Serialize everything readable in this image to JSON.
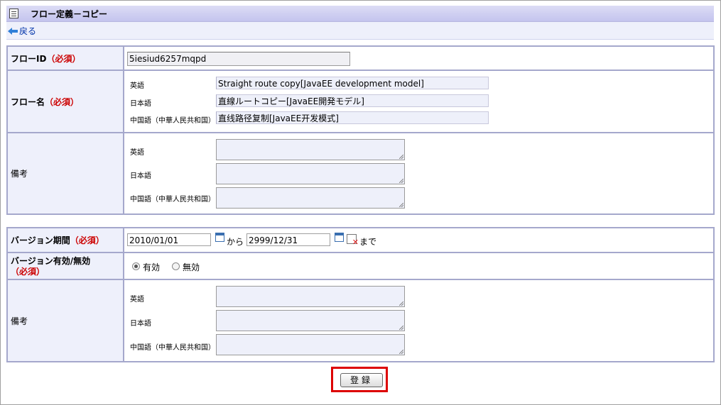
{
  "header": {
    "title": "フロー定義－コピー",
    "back_label": "戻る"
  },
  "flow": {
    "id_label": "フローID",
    "name_label": "フロー名",
    "required": "（必須）",
    "id_value": "5iesiud6257mqpd",
    "name_values": {
      "en": "Straight route copy[JavaEE development model]",
      "ja": "直線ルートコピー[JavaEE開発モデル]",
      "zh": "直线路径复制[JavaEE开发模式]"
    },
    "remarks_label": "備考"
  },
  "languages": {
    "en": "英語",
    "ja": "日本語",
    "zh": "中国語（中華人民共和国）"
  },
  "version": {
    "period_label": "バージョン期間",
    "required": "（必須）",
    "start_date": "2010/01/01",
    "from_text": "から",
    "end_date": "2999/12/31",
    "until_text": "まで",
    "validity_label": "バージョン有効/無効",
    "validity_required": "（必須）",
    "option_valid": "有効",
    "option_invalid": "無効",
    "selected": "有効",
    "remarks_label": "備考"
  },
  "actions": {
    "submit_label": "登録"
  }
}
